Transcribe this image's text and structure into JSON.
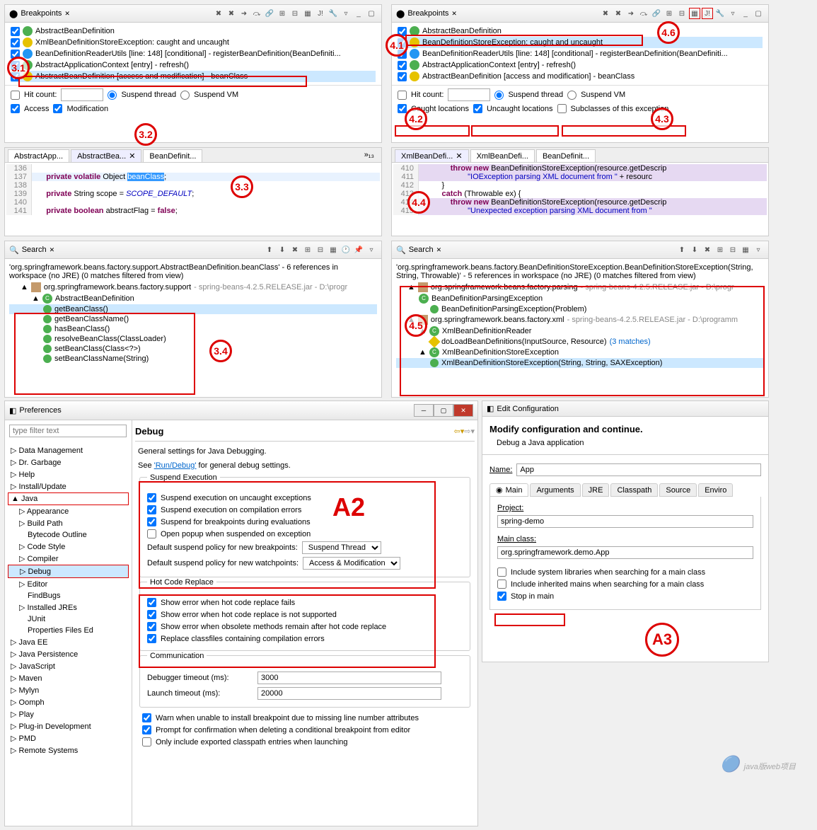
{
  "bp_left": {
    "title": "Breakpoints",
    "items": [
      {
        "icon": "green",
        "text": "AbstractBeanDefinition"
      },
      {
        "icon": "yell",
        "text": "XmlBeanDefinitionStoreException: caught and uncaught"
      },
      {
        "icon": "blue",
        "text": "BeanDefinitionReaderUtils [line: 148] [conditional] - registerBeanDefinition(BeanDefiniti..."
      },
      {
        "icon": "green",
        "text": "AbstractApplicationContext [entry] - refresh()"
      },
      {
        "icon": "yell",
        "text": "AbstractBeanDefinition [access and modification] - beanClass"
      }
    ],
    "hit_count": "Hit count:",
    "suspend_thread": "Suspend thread",
    "suspend_vm": "Suspend VM",
    "access": "Access",
    "modification": "Modification"
  },
  "bp_right": {
    "title": "Breakpoints",
    "items": [
      {
        "icon": "green",
        "text": "AbstractBeanDefinition"
      },
      {
        "icon": "yell",
        "text": "BeanDefinitionStoreException: caught and uncaught"
      },
      {
        "icon": "blue",
        "text": "BeanDefinitionReaderUtils [line: 148] [conditional] - registerBeanDefinition(BeanDefiniti..."
      },
      {
        "icon": "green",
        "text": "AbstractApplicationContext [entry] - refresh()"
      },
      {
        "icon": "yell",
        "text": "AbstractBeanDefinition [access and modification] - beanClass"
      }
    ],
    "hit_count": "Hit count:",
    "suspend_thread": "Suspend thread",
    "suspend_vm": "Suspend VM",
    "caught": "Caught locations",
    "uncaught": "Uncaught locations",
    "subclasses": "Subclasses of this exception"
  },
  "code_left": {
    "tabs": [
      "AbstractApp...",
      "AbstractBea...",
      "BeanDefinit..."
    ],
    "lines": [
      {
        "n": "136",
        "t": ""
      },
      {
        "n": "137",
        "t": "    private volatile Object beanClass;",
        "hl": "beanClass"
      },
      {
        "n": "138",
        "t": ""
      },
      {
        "n": "139",
        "t": "    private String scope = SCOPE_DEFAULT;"
      },
      {
        "n": "140",
        "t": ""
      },
      {
        "n": "141",
        "t": "    private boolean abstractFlag = false;"
      }
    ]
  },
  "code_right": {
    "tabs": [
      "XmlBeanDefi...",
      "XmlBeanDefi...",
      "BeanDefinit..."
    ],
    "lines": [
      {
        "n": "410",
        "t": "            throw new BeanDefinitionStoreException(resource.getDescrip"
      },
      {
        "n": "411",
        "t": "                    \"IOException parsing XML document from \" + resourc"
      },
      {
        "n": "412",
        "t": "        }"
      },
      {
        "n": "413",
        "t": "        catch (Throwable ex) {"
      },
      {
        "n": "414",
        "t": "            throw new BeanDefinitionStoreException(resource.getDescrip"
      },
      {
        "n": "415",
        "t": "                    \"Unexpected exception parsing XML document from \""
      }
    ]
  },
  "search_left": {
    "title": "Search",
    "summary": "'org.springframework.beans.factory.support.AbstractBeanDefinition.beanClass' - 6 references in workspace (no JRE) (0 matches filtered from view)",
    "pkg": "org.springframework.beans.factory.support",
    "pkg_gray": " - spring-beans-4.2.5.RELEASE.jar - D:\\progr",
    "cls": "AbstractBeanDefinition",
    "methods": [
      "getBeanClass()",
      "getBeanClassName()",
      "hasBeanClass()",
      "resolveBeanClass(ClassLoader)",
      "setBeanClass(Class<?>)",
      "setBeanClassName(String)"
    ]
  },
  "search_right": {
    "title": "Search",
    "summary": "'org.springframework.beans.factory.BeanDefinitionStoreException.BeanDefinitionStoreException(String, String, Throwable)' - 5 references in workspace (no JRE) (0 matches filtered from view)",
    "pkg1": "org.springframework.beans.factory.parsing",
    "pkg1_gray": " - spring-beans-4.2.5.RELEASE.jar - D:\\progr",
    "cls1": "BeanDefinitionParsingException",
    "m1": "BeanDefinitionParsingException(Problem)",
    "pkg2": "org.springframework.beans.factory.xml",
    "pkg2_gray": " - spring-beans-4.2.5.RELEASE.jar - D:\\programm",
    "cls2": "XmlBeanDefinitionReader",
    "m2a": "doLoadBeanDefinitions(InputSource, Resource)",
    "m2a_matches": "(3 matches)",
    "cls3": "XmlBeanDefinitionStoreException",
    "m3": "XmlBeanDefinitionStoreException(String, String, SAXException)"
  },
  "pref": {
    "title": "Preferences",
    "filter_placeholder": "type filter text",
    "tree": [
      "Data Management",
      "Dr. Garbage",
      "Help",
      "Install/Update",
      "Java",
      "Appearance",
      "Build Path",
      "Bytecode Outline",
      "Code Style",
      "Compiler",
      "Debug",
      "Editor",
      "FindBugs",
      "Installed JREs",
      "JUnit",
      "Properties Files Ed",
      "Java EE",
      "Java Persistence",
      "JavaScript",
      "Maven",
      "Mylyn",
      "Oomph",
      "Play",
      "Plug-in Development",
      "PMD",
      "Remote Systems"
    ],
    "page_title": "Debug",
    "desc1": "General settings for Java Debugging.",
    "desc2a": "See ",
    "desc2_link": "'Run/Debug'",
    "desc2b": " for general debug settings.",
    "suspend_title": "Suspend Execution",
    "s1": "Suspend execution on uncaught exceptions",
    "s2": "Suspend execution on compilation errors",
    "s3": "Suspend for breakpoints during evaluations",
    "s4": "Open popup when suspended on exception",
    "policy1_label": "Default suspend policy for new breakpoints:",
    "policy1_val": "Suspend Thread",
    "policy2_label": "Default suspend policy for new watchpoints:",
    "policy2_val": "Access & Modification",
    "hot_title": "Hot Code Replace",
    "h1": "Show error when hot code replace fails",
    "h2": "Show error when hot code replace is not supported",
    "h3": "Show error when obsolete methods remain after hot code replace",
    "h4": "Replace classfiles containing compilation errors",
    "comm_title": "Communication",
    "comm1_label": "Debugger timeout (ms):",
    "comm1_val": "3000",
    "comm2_label": "Launch timeout (ms):",
    "comm2_val": "20000",
    "w1": "Warn when unable to install breakpoint due to missing line number attributes",
    "w2": "Prompt for confirmation when deleting a conditional breakpoint from editor",
    "w3": "Only include exported classpath entries when launching"
  },
  "edit_conf": {
    "title": "Edit Configuration",
    "subtitle": "Modify configuration and continue.",
    "desc": "Debug a Java application",
    "name_label": "Name:",
    "name_val": "App",
    "tabs": [
      "Main",
      "Arguments",
      "JRE",
      "Classpath",
      "Source",
      "Enviro"
    ],
    "project_label": "Project:",
    "project_val": "spring-demo",
    "main_label": "Main class:",
    "main_val": "org.springframework.demo.App",
    "c1": "Include system libraries when searching for a main class",
    "c2": "Include inherited mains when searching for a main class",
    "c3": "Stop in main"
  },
  "labels": {
    "l31": "3.1",
    "l32": "3.2",
    "l33": "3.3",
    "l34": "3.4",
    "l41": "4.1",
    "l42": "4.2",
    "l43": "4.3",
    "l44": "4.4",
    "l45": "4.5",
    "l46": "4.6",
    "a2": "A2",
    "a3": "A3"
  },
  "watermark": "java版web项目"
}
